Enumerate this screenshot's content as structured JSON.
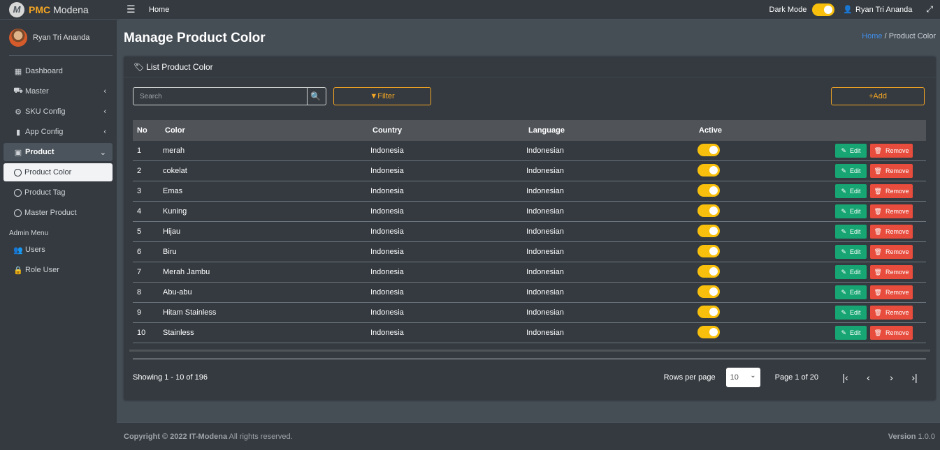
{
  "brand": {
    "logo_letter": "M",
    "pmc": "PMC",
    "name": "Modena"
  },
  "user": {
    "name": "Ryan Tri Ananda"
  },
  "sidebar": {
    "items": [
      {
        "label": "Dashboard",
        "icon": "grid-icon"
      },
      {
        "label": "Master",
        "icon": "car-icon"
      },
      {
        "label": "SKU Config",
        "icon": "gear-icon"
      },
      {
        "label": "App Config",
        "icon": "mobile-icon"
      },
      {
        "label": "Product",
        "icon": "briefcase-icon"
      },
      {
        "label": "Product Color",
        "icon": "circle-icon"
      },
      {
        "label": "Product Tag",
        "icon": "circle-icon"
      },
      {
        "label": "Master Product",
        "icon": "circle-icon"
      }
    ],
    "admin_header": "Admin Menu",
    "admin_items": [
      {
        "label": "Users",
        "icon": "users-icon"
      },
      {
        "label": "Role User",
        "icon": "lock-icon"
      }
    ]
  },
  "topbar": {
    "home": "Home",
    "dark_mode_label": "Dark Mode",
    "user_name": "Ryan Tri Ananda"
  },
  "page": {
    "title": "Manage Product Color",
    "breadcrumb_home": "Home",
    "breadcrumb_sep": "/",
    "breadcrumb_current": "Product Color"
  },
  "card": {
    "title": "List Product Color",
    "search_placeholder": "Search",
    "filter_label": "Filter",
    "add_label": "Add"
  },
  "table": {
    "headers": {
      "no": "No",
      "color": "Color",
      "country": "Country",
      "language": "Language",
      "active": "Active"
    },
    "edit_label": "Edit",
    "remove_label": "Remove",
    "rows": [
      {
        "no": "1",
        "color": "merah",
        "country": "Indonesia",
        "language": "Indonesian",
        "active": true
      },
      {
        "no": "2",
        "color": "cokelat",
        "country": "Indonesia",
        "language": "Indonesian",
        "active": true
      },
      {
        "no": "3",
        "color": "Emas",
        "country": "Indonesia",
        "language": "Indonesian",
        "active": true
      },
      {
        "no": "4",
        "color": "Kuning",
        "country": "Indonesia",
        "language": "Indonesian",
        "active": true
      },
      {
        "no": "5",
        "color": "Hijau",
        "country": "Indonesia",
        "language": "Indonesian",
        "active": true
      },
      {
        "no": "6",
        "color": "Biru",
        "country": "Indonesia",
        "language": "Indonesian",
        "active": true
      },
      {
        "no": "7",
        "color": "Merah Jambu",
        "country": "Indonesia",
        "language": "Indonesian",
        "active": true
      },
      {
        "no": "8",
        "color": "Abu-abu",
        "country": "Indonesia",
        "language": "Indonesian",
        "active": true
      },
      {
        "no": "9",
        "color": "Hitam Stainless",
        "country": "Indonesia",
        "language": "Indonesian",
        "active": true
      },
      {
        "no": "10",
        "color": "Stainless",
        "country": "Indonesia",
        "language": "Indonesian",
        "active": true
      }
    ]
  },
  "pagination": {
    "showing": "Showing 1 - 10 of 196",
    "rows_per_page_label": "Rows per page",
    "rows_per_page_value": "10",
    "page_label": "Page 1 of 20"
  },
  "footer": {
    "copyright_prefix": "Copyright © 2022",
    "company": "IT-Modena",
    "rights": "All rights reserved.",
    "version_label": "Version",
    "version_value": "1.0.0"
  },
  "colors": {
    "accent": "#f5a623",
    "toggle": "#f8c00c",
    "edit": "#17a673",
    "remove": "#e74c3c",
    "sidebar_bg": "#343a40",
    "content_bg": "#454d55",
    "link": "#3f8ee8"
  }
}
